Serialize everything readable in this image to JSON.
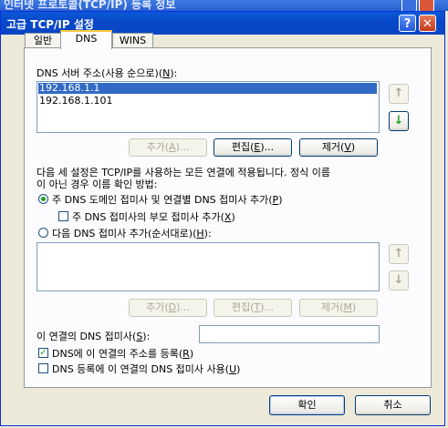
{
  "background_window": {
    "title": "인터넷 프로토콜(TCP/IP) 등록 정보"
  },
  "dialog": {
    "title": "고급 TCP/IP 설정",
    "help_label": "?",
    "close_label": "✕",
    "tabs": [
      {
        "label": "일반"
      },
      {
        "label": "DNS"
      },
      {
        "label": "WINS"
      }
    ],
    "dns_servers": {
      "label_prefix": "DNS 서버 주소(사용 순으로)(",
      "label_key": "N",
      "label_suffix": "):",
      "items": [
        "192.168.1.1",
        "192.168.1.101"
      ],
      "up_icon": "↑",
      "down_icon": "↓"
    },
    "server_buttons": {
      "add_prefix": "추가(",
      "add_key": "A",
      "add_suffix": ")...",
      "edit_prefix": "편집(",
      "edit_key": "E",
      "edit_suffix": ")...",
      "remove_prefix": "제거(",
      "remove_key": "V",
      "remove_suffix": ")"
    },
    "description_line1": "다음 세 설정은 TCP/IP를 사용하는 모든 연결에 적용됩니다. 정식 이름",
    "description_line2": "이 아닌 경우 이름 확인 방법:",
    "radio_primary": {
      "prefix": "주 DNS 도메인 접미사 및 연결별 DNS 접미사 추가(",
      "key": "P",
      "suffix": ")",
      "checked": true
    },
    "check_parent": {
      "prefix": "주 DNS 접미사의 부모 접미사 추가(",
      "key": "X",
      "suffix": ")",
      "checked": false
    },
    "radio_ordered": {
      "prefix": "다음 DNS 접미사 추가(순서대로)(",
      "key": "H",
      "suffix": "):",
      "checked": false
    },
    "suffix_list": {
      "items": [],
      "up_icon": "↑",
      "down_icon": "↓"
    },
    "suffix_buttons": {
      "add_prefix": "추가(",
      "add_key": "D",
      "add_suffix": ")...",
      "edit_prefix": "편집(",
      "edit_key": "T",
      "edit_suffix": ")...",
      "remove_prefix": "제거(",
      "remove_key": "M",
      "remove_suffix": ")"
    },
    "connection_suffix": {
      "prefix": "이 연결의 DNS 접미사(",
      "key": "S",
      "suffix": "):",
      "value": ""
    },
    "check_register": {
      "prefix": "DNS에 이 연결의 주소를 등록(",
      "key": "R",
      "suffix": ")",
      "checked": true
    },
    "check_use_suffix": {
      "prefix": "DNS 등록에 이 연결의 DNS 접미사 사용(",
      "key": "U",
      "suffix": ")",
      "checked": false
    },
    "ok_label": "확인",
    "cancel_label": "취소",
    "colors": {
      "titlebar": "#0a5ad8",
      "selection": "#316ac5",
      "face": "#ece9d8",
      "accent_green": "#21a121"
    }
  }
}
